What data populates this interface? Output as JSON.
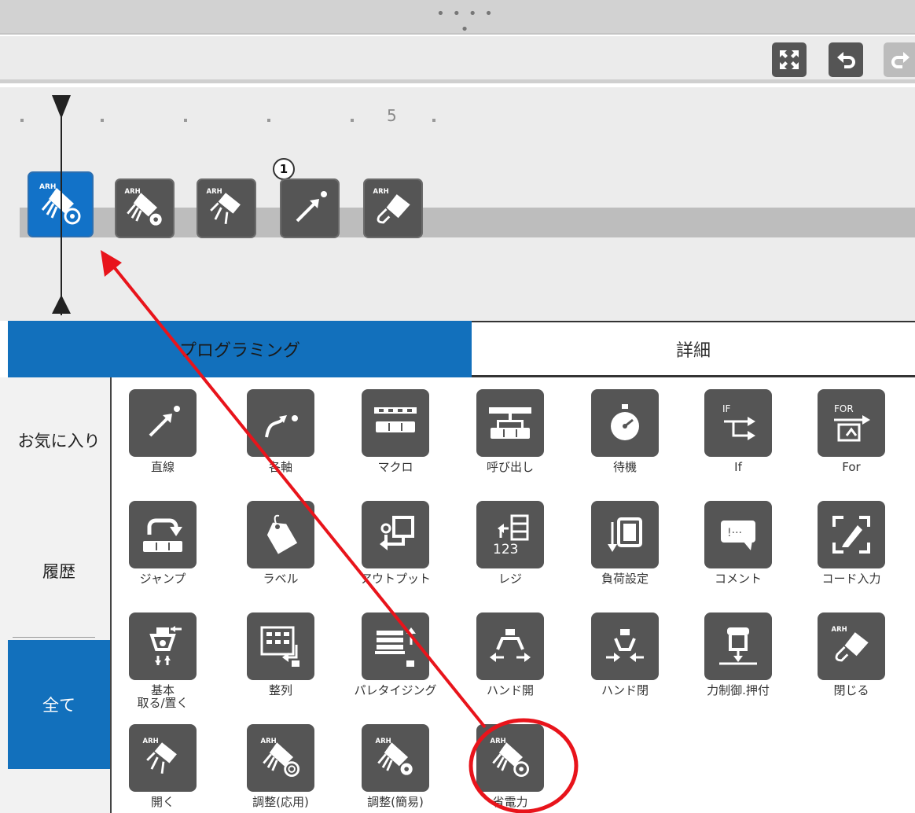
{
  "window": {
    "drag_handle": "• • • • •"
  },
  "toolbar": {
    "buttons": [
      {
        "name": "fullscreen-icon"
      },
      {
        "name": "undo-icon"
      },
      {
        "name": "redo-icon"
      }
    ]
  },
  "timeline": {
    "ruler_label": "5",
    "step_badge": "1",
    "blocks": [
      {
        "icon": "arh-power-saving-icon",
        "selected": true
      },
      {
        "icon": "arh-adjust-icon",
        "selected": false
      },
      {
        "icon": "arh-open-icon",
        "selected": false
      },
      {
        "icon": "linear-move-icon",
        "selected": false
      },
      {
        "icon": "arh-close-icon",
        "selected": false
      }
    ]
  },
  "tabs": {
    "programming": "プログラミング",
    "details": "詳細"
  },
  "sidebar": {
    "favorites": "お気に入り",
    "history": "履歴",
    "all": "全て"
  },
  "palette": {
    "rows": [
      [
        {
          "label": "直線",
          "icon": "linear-icon"
        },
        {
          "label": "各軸",
          "icon": "joint-move-icon"
        },
        {
          "label": "マクロ",
          "icon": "macro-icon"
        },
        {
          "label": "呼び出し",
          "icon": "call-icon"
        },
        {
          "label": "待機",
          "icon": "stopwatch-icon"
        },
        {
          "label": "If",
          "icon": "if-icon"
        },
        {
          "label": "For",
          "icon": "for-icon"
        }
      ],
      [
        {
          "label": "ジャンプ",
          "icon": "jump-icon"
        },
        {
          "label": "ラベル",
          "icon": "tag-icon"
        },
        {
          "label": "アウトプット",
          "icon": "output-icon"
        },
        {
          "label": "レジ",
          "icon": "register-icon"
        },
        {
          "label": "負荷設定",
          "icon": "payload-icon"
        },
        {
          "label": "コメント",
          "icon": "comment-icon"
        },
        {
          "label": "コード入力",
          "icon": "code-input-icon"
        }
      ],
      [
        {
          "label": "基本\n取る/置く",
          "icon": "pick-place-icon"
        },
        {
          "label": "整列",
          "icon": "align-icon"
        },
        {
          "label": "パレタイジング",
          "icon": "palletizing-icon"
        },
        {
          "label": "ハンド開",
          "icon": "hand-open-icon"
        },
        {
          "label": "ハンド閉",
          "icon": "hand-close-icon"
        },
        {
          "label": "力制御.押付",
          "icon": "force-press-icon"
        },
        {
          "label": "閉じる",
          "icon": "arh-close-icon"
        }
      ],
      [
        {
          "label": "開く",
          "icon": "arh-open-icon"
        },
        {
          "label": "調整(応用)",
          "icon": "arh-adjust-advanced-icon"
        },
        {
          "label": "調整(簡易)",
          "icon": "arh-adjust-simple-icon"
        },
        {
          "label": "省電力",
          "icon": "arh-power-saving-icon"
        }
      ]
    ]
  },
  "annotation": {
    "color": "#e8141b"
  }
}
